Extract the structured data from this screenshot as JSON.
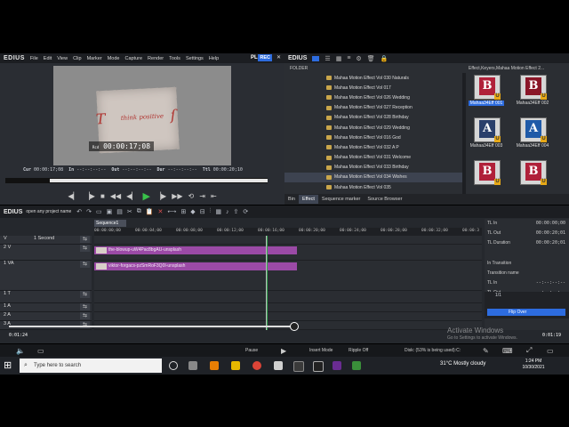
{
  "player": {
    "app_logo": "EDIUS",
    "menu": [
      "File",
      "Edit",
      "View",
      "Clip",
      "Marker",
      "Mode",
      "Capture",
      "Render",
      "Tools",
      "Settings",
      "Help"
    ],
    "plr": "PLR",
    "rec": "REC",
    "overlay_timecode": "00:00:17;08",
    "overlay_prefix": "Rcd",
    "cur_label": "Cur",
    "cur_value": "00:00:17;08",
    "in_label": "In",
    "in_value": "--:--:--:--",
    "out_label": "Out",
    "out_value": "--:--:--:--",
    "dur_label": "Dur",
    "dur_value": "--:--:--:--",
    "ttl_label": "Ttl",
    "ttl_value": "00:00:20;10",
    "paper_text": "think positive"
  },
  "bin": {
    "app_logo": "EDIUS",
    "folder_header": "FOLDER",
    "effect_path": "Effect,Keyers,Mahaa Motion Effect 2...",
    "folders": [
      "Mahaa Motion Effect Vol 030 Naturals",
      "Mahaa Motion Effect Vol 017",
      "Mahaa Motion Effect Vol 026 Wedding",
      "Mahaa Motion Effect Vol 027 Reception",
      "Mahaa Motion Effect Vol 028 Birthday",
      "Mahaa Motion Effect Vol 029 Wedding",
      "Mahaa Motion Effect Vol 016 God",
      "Mahaa Motion Effect Vol 032 A P",
      "Mahaa Motion Effect Vol 031 Welcome",
      "Mahaa Motion Effect Vol 033 Birthday",
      "Mahaa Motion Effect Vol 034 Wishes",
      "Mahaa Motion Effect Vol 035"
    ],
    "selected_folder_index": 10,
    "thumbs": [
      {
        "label": "Mahaa34Eff 001",
        "letter": "B",
        "color": "#b0213a",
        "selected": true
      },
      {
        "label": "Mahaa34Eff 002",
        "letter": "B",
        "color": "#8a1628",
        "selected": false
      },
      {
        "label": "Mahaa34Eff 003",
        "letter": "A",
        "color": "#2a3f6b",
        "selected": false
      },
      {
        "label": "Mahaa34Eff 004",
        "letter": "A",
        "color": "#1f5aa8",
        "selected": false
      },
      {
        "label": "",
        "letter": "B",
        "color": "#b0213a",
        "selected": false
      },
      {
        "label": "",
        "letter": "B",
        "color": "#b0213a",
        "selected": false
      }
    ],
    "tabs": [
      "Bin",
      "Effect",
      "Sequence marker",
      "Source Browser"
    ],
    "active_tab": "Effect"
  },
  "timeline": {
    "app_logo": "EDIUS",
    "project_name": "open any project name",
    "sequence_tab": "Sequence1",
    "ruler": [
      "00:00:00;00",
      "00:00:04;00",
      "00:00:08;00",
      "00:00:12;00",
      "00:00:16;00",
      "00:00:20;00",
      "00:00:24;00",
      "00:00:28;00",
      "00:00:32;00",
      "00:00:3"
    ],
    "tracks": [
      {
        "label": "V",
        "name": "1 Second"
      },
      {
        "label": "2 V",
        "name": ""
      },
      {
        "label": "1 VA",
        "name": ""
      },
      {
        "label": "1 T",
        "name": ""
      },
      {
        "label": "1 A",
        "name": ""
      },
      {
        "label": "2 A",
        "name": ""
      },
      {
        "label": "3 A",
        "name": ""
      }
    ],
    "clips": [
      {
        "name": "the-blowup-uW4Pac8bgAU-unsplash"
      },
      {
        "name": "viktor-forgacs-pzSmRoF3Q0I-unsplash"
      }
    ],
    "zoom_left": "0:01:24",
    "zoom_right": "0:01:19"
  },
  "info": {
    "rows": [
      {
        "k": "TL In",
        "v": "00:00:00;00"
      },
      {
        "k": "TL Out",
        "v": "00:00:20;01"
      },
      {
        "k": "TL Duration",
        "v": "00:00:20;01"
      },
      {
        "k": "In Transition",
        "v": ""
      },
      {
        "k": "Transition name",
        "v": ""
      },
      {
        "k": "TL In",
        "v": "--:--:--:--"
      },
      {
        "k": "TL Out",
        "v": "--:--:--:--"
      }
    ],
    "page": "1/1",
    "flip_item": "Flip Over"
  },
  "status": {
    "pause": "Pause",
    "insert_mode": "Insert Mode",
    "ripple": "Ripple Off",
    "disk": "Disk: (53% is being used):C:"
  },
  "watermark": {
    "line1": "Activate Windows",
    "line2": "Go to Settings to activate Windows."
  },
  "taskbar": {
    "search_placeholder": "Type here to search",
    "weather": "31°C  Mostly cloudy",
    "time": "1:24 PM",
    "date": "10/30/2021"
  }
}
